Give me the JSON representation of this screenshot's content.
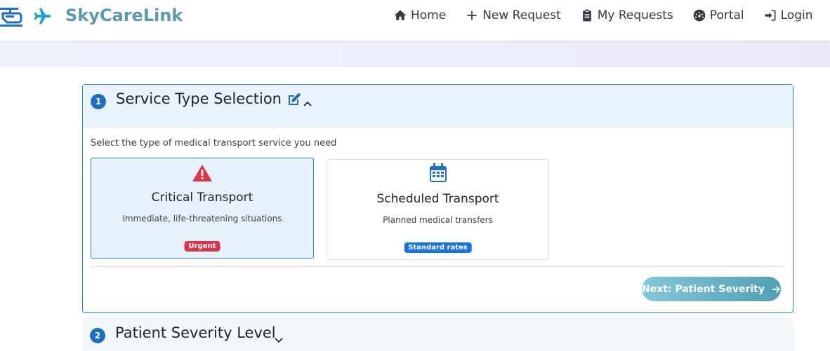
{
  "brand": {
    "name": "SkyCareLink",
    "color": "#5b9aa6"
  },
  "nav": {
    "items": [
      {
        "label": "Home",
        "icon": "home-icon"
      },
      {
        "label": "New Request",
        "icon": "plus-icon"
      },
      {
        "label": "My Requests",
        "icon": "clipboard-icon"
      },
      {
        "label": "Portal",
        "icon": "gauge-icon"
      },
      {
        "label": "Login",
        "icon": "login-icon"
      },
      {
        "label": "",
        "icon": "user-plus-icon"
      }
    ]
  },
  "step1": {
    "number": "1",
    "title": "Service Type Selection",
    "instruction": "Select the type of medical transport service you need",
    "options": [
      {
        "title": "Critical Transport",
        "description": "Immediate, life-threatening situations",
        "badge": "Urgent",
        "icon": "warning-triangle-icon",
        "selected": true
      },
      {
        "title": "Scheduled Transport",
        "description": "Planned medical transfers",
        "badge": "Standard rates",
        "icon": "calendar-icon",
        "selected": false
      }
    ],
    "next_label": "Next: Patient Severity"
  },
  "step2": {
    "number": "2",
    "title": "Patient Severity Level"
  },
  "colors": {
    "accent": "#1e6fc1",
    "urgent": "#d7374a",
    "standard": "#1a73e0",
    "critical_icon": "#dc3545"
  }
}
